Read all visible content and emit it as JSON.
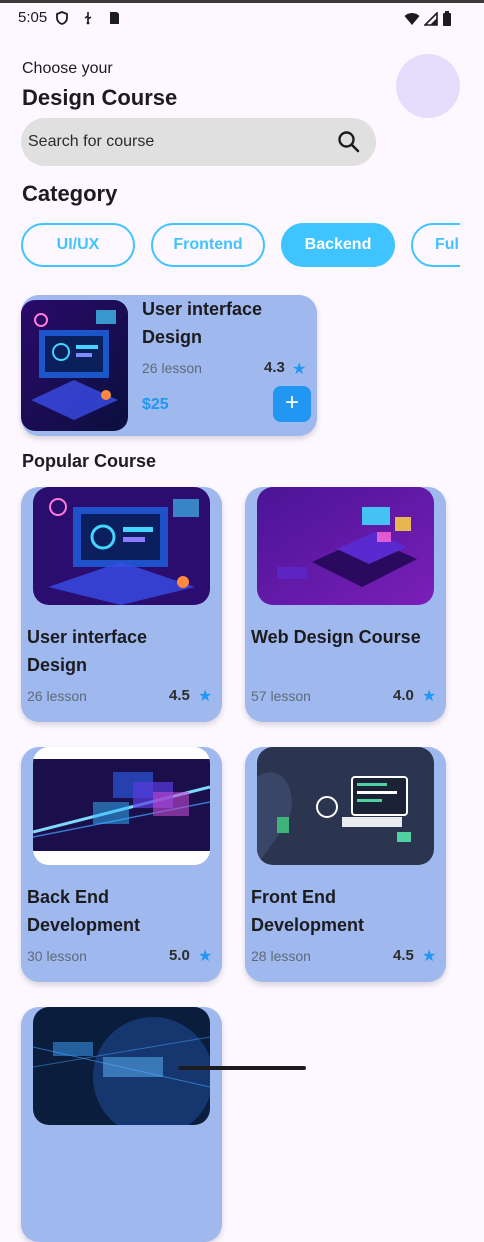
{
  "status": {
    "time": "5:05"
  },
  "header": {
    "eyebrow": "Choose your",
    "title": "Design Course"
  },
  "search": {
    "placeholder": "Search for course"
  },
  "category": {
    "title": "Category",
    "chips": [
      "UI/UX",
      "Frontend",
      "Backend",
      "Full"
    ],
    "selected": "Backend"
  },
  "featured": {
    "title": "User interface Design",
    "lessons": "26 lesson",
    "rating": "4.3",
    "price": "$25",
    "add_label": "+"
  },
  "popular": {
    "title": "Popular Course",
    "courses": [
      {
        "title": "User interface Design",
        "lessons": "26  lesson",
        "rating": "4.5"
      },
      {
        "title": "Web Design Course",
        "lessons": "57 lesson",
        "rating": "4.0"
      },
      {
        "title": "Back End Development",
        "lessons": "30 lesson",
        "rating": "5.0"
      },
      {
        "title": "Front End Development",
        "lessons": "28 lesson",
        "rating": "4.5"
      }
    ]
  },
  "colors": {
    "accent": "#40c4ff",
    "card": "#9fb8ed",
    "star": "#2196f3"
  }
}
